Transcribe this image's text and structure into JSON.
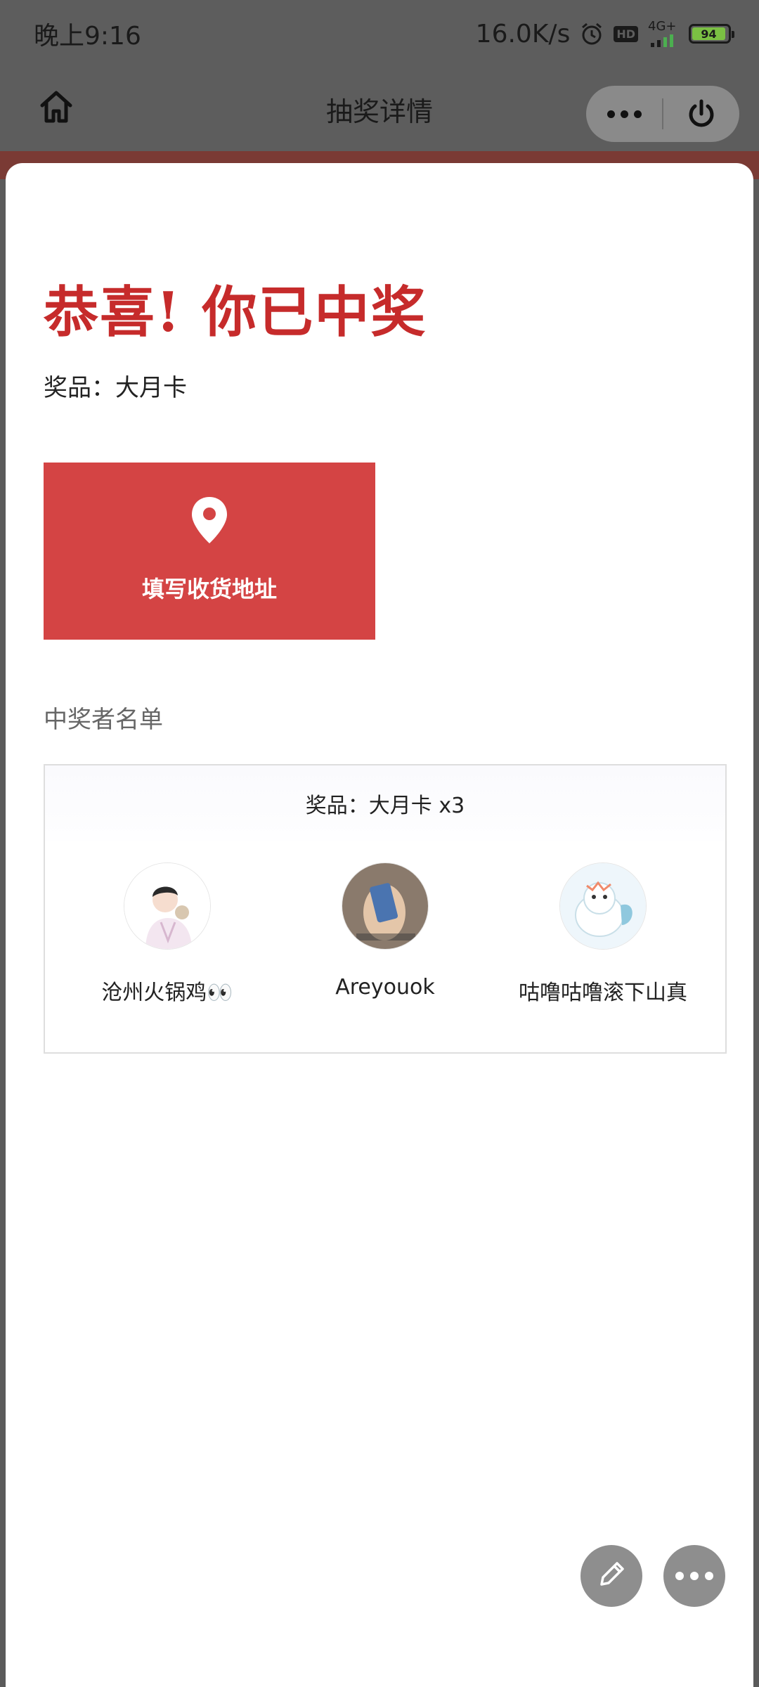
{
  "status_bar": {
    "time": "晚上9:16",
    "net_speed": "16.0K/s",
    "hd_label": "HD",
    "network_label": "4G+",
    "battery_level": "94",
    "battery_fraction": 0.94
  },
  "nav": {
    "title": "抽奖详情"
  },
  "result": {
    "congrats_title": "恭喜! 你已中奖",
    "prize_line": "奖品：大月卡",
    "address_button_label": "填写收货地址",
    "winners_heading": "中奖者名单"
  },
  "winners_box": {
    "header": "奖品：大月卡 x3",
    "winners": [
      {
        "name": "沧州火锅鸡👀",
        "avatar_icon": "avatar-boy-cartoon"
      },
      {
        "name": "Areyouok",
        "avatar_icon": "avatar-hand-photo"
      },
      {
        "name": "咕噜咕噜滚下山真",
        "avatar_icon": "avatar-lion-cartoon"
      }
    ]
  },
  "colors": {
    "accent_red": "#c62b2b",
    "button_red": "#d44444",
    "fab_gray": "#8e8e8e"
  }
}
